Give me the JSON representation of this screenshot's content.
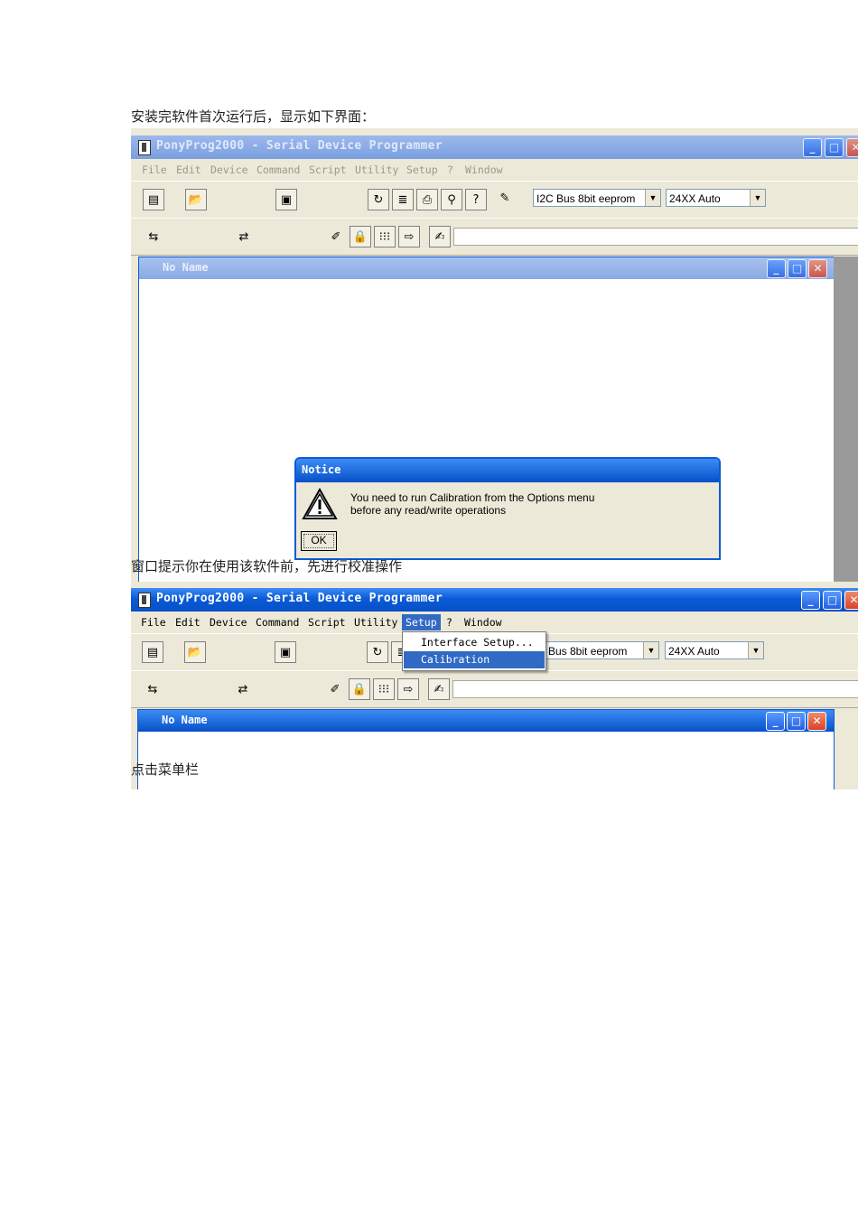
{
  "captions": {
    "intro": "安装完软件首次运行后，显示如下界面：",
    "notice_desc": "窗口提示你在使用该软件前，先进行校准操作",
    "click_menu": "点击菜单栏"
  },
  "app": {
    "title": "PonyProg2000 - Serial Device Programmer",
    "menu": [
      "File",
      "Edit",
      "Device",
      "Command",
      "Script",
      "Utility",
      "Setup",
      "?",
      "Window"
    ],
    "device_family": "I2C Bus 8bit eeprom",
    "device_family_partial": "Bus 8bit eeprom",
    "device_type": "24XX Auto",
    "child_title": "No Name",
    "window_buttons": {
      "minimize": "_",
      "maximize": "□",
      "close": "✕"
    }
  },
  "notice": {
    "title": "Notice",
    "line1": "You need to run Calibration from the Options menu",
    "line2": "before any read/write operations",
    "ok_label": "OK"
  },
  "setup_menu": {
    "items": [
      "Interface Setup...",
      "Calibration"
    ],
    "selected": "Calibration"
  },
  "icons": [
    "new-icon",
    "open-icon",
    "save-icon",
    "reload-icon",
    "edit-icon",
    "print-icon",
    "zoom-icon",
    "help-icon",
    "chip-icon",
    "read-icon",
    "write-icon",
    "erase-icon",
    "lock-icon",
    "fuse-icon",
    "arrow-icon",
    "script-icon",
    "warning-icon",
    "app-icon"
  ],
  "colors": {
    "titlebar": "#0a5bd6",
    "selection": "#316ac5",
    "face": "#ece9d8"
  }
}
